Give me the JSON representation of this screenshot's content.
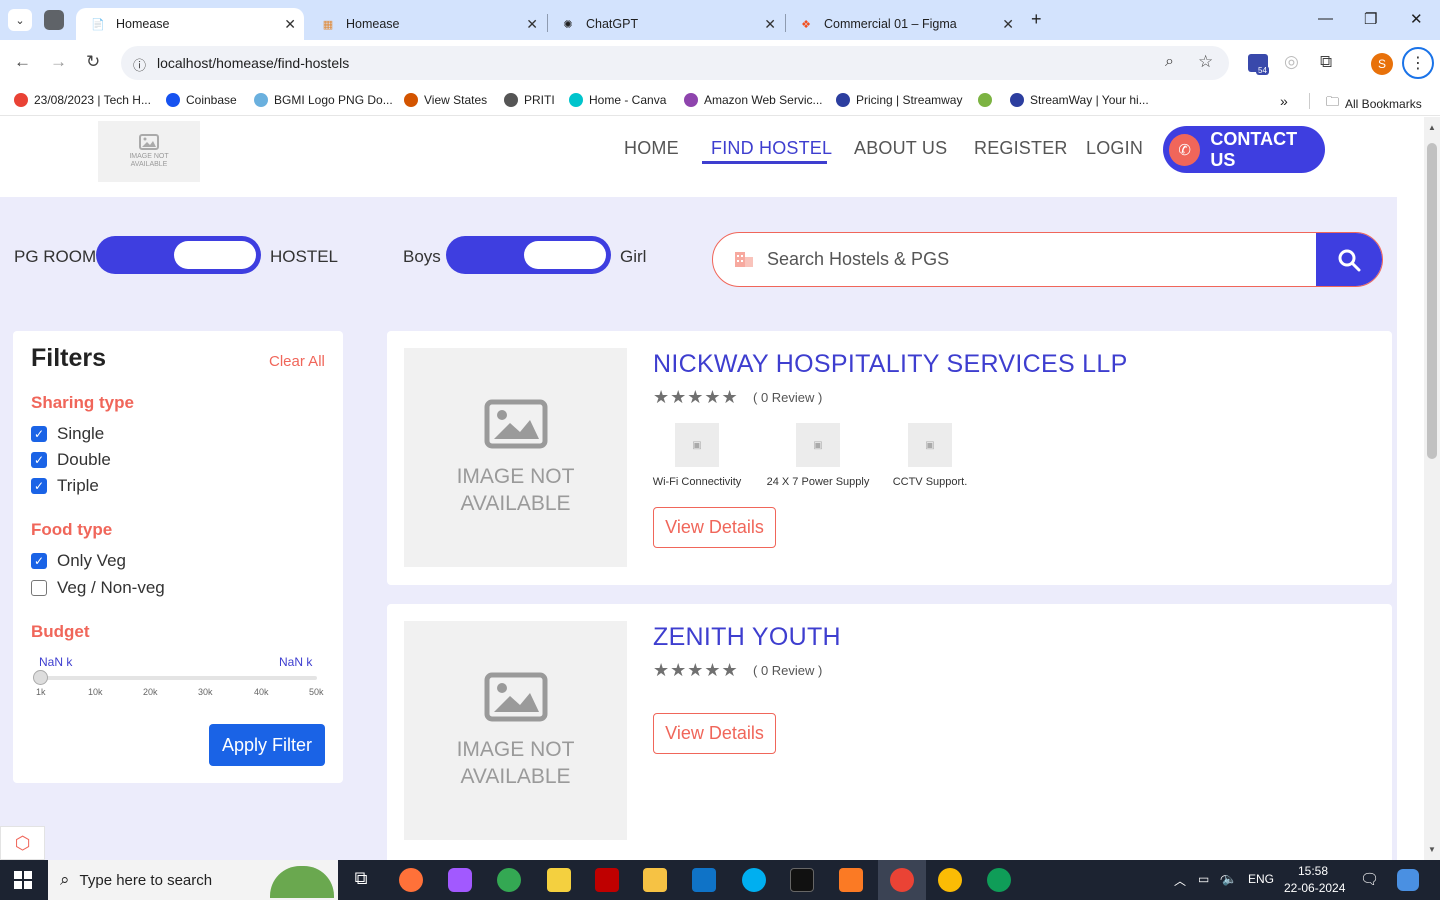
{
  "browser": {
    "tabs": [
      {
        "title": "Homease",
        "active": true
      },
      {
        "title": "Homease",
        "active": false
      },
      {
        "title": "ChatGPT",
        "active": false
      },
      {
        "title": "Commercial 01 – Figma",
        "active": false
      }
    ],
    "url": "localhost/homease/find-hostels",
    "extension_badge": "54",
    "profile_initial": "S",
    "bookmarks": [
      {
        "label": "23/08/2023 | Tech H...",
        "color": "#e94235"
      },
      {
        "label": "Coinbase",
        "color": "#1652f0"
      },
      {
        "label": "BGMI Logo PNG Do...",
        "color": "#6ab0de"
      },
      {
        "label": "View States",
        "color": "#d35400"
      },
      {
        "label": "PRITI",
        "color": "#555555"
      },
      {
        "label": "Home - Canva",
        "color": "#00c4cc"
      },
      {
        "label": "Amazon Web Servic...",
        "color": "#8e44ad"
      },
      {
        "label": "Pricing | Streamway",
        "color": "#2c3e9f"
      },
      {
        "label": "",
        "color": "#7cb342"
      },
      {
        "label": "StreamWay | Your hi...",
        "color": "#2c3e9f"
      }
    ],
    "all_bookmarks": "All Bookmarks"
  },
  "navbar": {
    "logo_text": "IMAGE NOT AVAILABLE",
    "links": [
      "HOME",
      "FIND HOSTEL",
      "ABOUT US",
      "REGISTER",
      "LOGIN"
    ],
    "active_link": "FIND HOSTEL",
    "contact_label": "CONTACT US"
  },
  "search": {
    "toggle1_left": "PG ROOM",
    "toggle1_right": "HOSTEL",
    "toggle2_left": "Boys",
    "toggle2_right": "Girl",
    "placeholder": "Search Hostels & PGS"
  },
  "filters": {
    "title": "Filters",
    "clear_all": "Clear All",
    "sharing_title": "Sharing type",
    "sharing": [
      {
        "label": "Single",
        "checked": true
      },
      {
        "label": "Double",
        "checked": true
      },
      {
        "label": "Triple",
        "checked": true
      }
    ],
    "food_title": "Food type",
    "food": [
      {
        "label": "Only Veg",
        "checked": true
      },
      {
        "label": "Veg / Non-veg",
        "checked": false
      }
    ],
    "budget_title": "Budget",
    "budget_min": "NaN k",
    "budget_max": "NaN k",
    "ticks": [
      "1k",
      "10k",
      "20k",
      "30k",
      "40k",
      "50k"
    ],
    "apply_label": "Apply Filter"
  },
  "listings": [
    {
      "image_text": "IMAGE NOT AVAILABLE",
      "title": "NICKWAY HOSPITALITY SERVICES LLP",
      "stars": "★★★★★",
      "reviews": "( 0 Review )",
      "amenities": [
        "Wi-Fi Connectivity",
        "24 X 7 Power Supply",
        "CCTV Support."
      ],
      "button": "View Details"
    },
    {
      "image_text": "IMAGE NOT AVAILABLE",
      "title": "ZENITH YOUTH",
      "stars": "★★★★★",
      "reviews": "( 0 Review )",
      "amenities": [],
      "button": "View Details"
    }
  ],
  "taskbar": {
    "search_placeholder": "Type here to search",
    "lang": "ENG",
    "time": "15:58",
    "date": "22-06-2024"
  }
}
